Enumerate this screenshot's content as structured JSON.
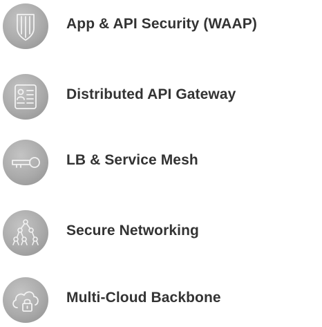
{
  "features": [
    {
      "label": "App & API Security (WAAP)",
      "icon": "shield-icon"
    },
    {
      "label": "Distributed API Gateway",
      "icon": "id-card-icon"
    },
    {
      "label": "LB & Service Mesh",
      "icon": "key-icon"
    },
    {
      "label": "Secure Networking",
      "icon": "network-tree-icon"
    },
    {
      "label": "Multi-Cloud Backbone",
      "icon": "cloud-lock-icon"
    }
  ],
  "colors": {
    "icon_background": "#aaaaaa",
    "icon_stroke": "#f2f2f2",
    "label_text": "#333333"
  }
}
